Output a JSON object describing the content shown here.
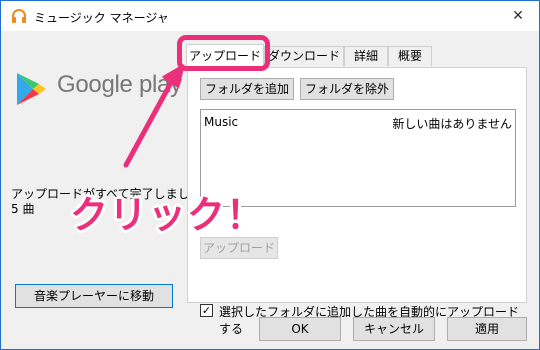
{
  "window": {
    "title": "ミュージック マネージャ",
    "close_glyph": "✕"
  },
  "brand": {
    "logo_text": "Google play"
  },
  "status": {
    "line1": "アップロードがすべて完了しました",
    "line2": "5 曲"
  },
  "left_button": "音楽プレーヤーに移動",
  "tabs": [
    {
      "label": "アップロード",
      "active": true
    },
    {
      "label": "ダウンロード",
      "active": false
    },
    {
      "label": "詳細",
      "active": false
    },
    {
      "label": "概要",
      "active": false
    }
  ],
  "upload_panel": {
    "add_folder": "フォルダを追加",
    "remove_folder": "フォルダを除外",
    "folders": [
      {
        "name": "Music",
        "status": "新しい曲はありません"
      }
    ],
    "upload_button": "アップロード",
    "auto_upload": {
      "checked": true,
      "check_glyph": "✓",
      "label": "選択したフォルダに追加した曲を自動的にアップロードする"
    }
  },
  "footer": {
    "ok": "OK",
    "cancel": "キャンセル",
    "apply": "適用"
  },
  "annotation": {
    "callout": "クリック！",
    "color": "#ec2f7a"
  }
}
